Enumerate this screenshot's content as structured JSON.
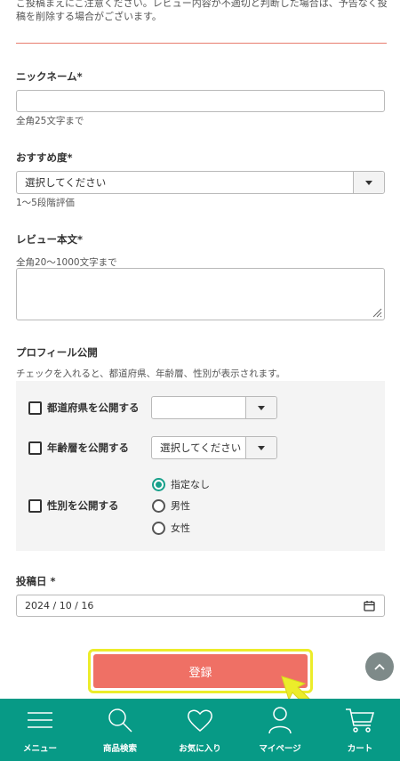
{
  "notice": {
    "text": "ご投稿まえにご注意ください。レビュー内容が不適切と判断した場合は、予告なく投稿を削除する場合がございます。"
  },
  "form": {
    "nickname": {
      "label": "ニックネーム*",
      "value": "",
      "hint": "全角25文字まで"
    },
    "rating": {
      "label": "おすすめ度*",
      "selected": "選択してください",
      "hint": "1〜5段階評価"
    },
    "review": {
      "label": "レビュー本文*",
      "hint": "全角20〜1000文字まで",
      "value": ""
    },
    "profile": {
      "label": "プロフィール公開",
      "hint": "チェックを入れると、都道府県、年齢層、性別が表示されます。",
      "prefecture": {
        "label": "都道府県を公開する",
        "selected": ""
      },
      "age": {
        "label": "年齢層を公開する",
        "selected": "選択してください"
      },
      "gender": {
        "label": "性別を公開する",
        "options": [
          "指定なし",
          "男性",
          "女性"
        ],
        "selected": "指定なし"
      }
    },
    "post_date": {
      "label": "投稿日 *",
      "value": "2024 / 10 / 16"
    },
    "submit_label": "登録"
  },
  "bottom_nav": {
    "items": [
      {
        "label": "メニュー",
        "icon": "menu-icon"
      },
      {
        "label": "商品検索",
        "icon": "search-icon"
      },
      {
        "label": "お気に入り",
        "icon": "heart-icon"
      },
      {
        "label": "マイページ",
        "icon": "user-icon"
      },
      {
        "label": "カート",
        "icon": "cart-icon"
      }
    ]
  },
  "colors": {
    "accent": "#079a86",
    "submit": "#ef7065",
    "highlight": "#ecec2a",
    "divider": "#e87d6f"
  }
}
